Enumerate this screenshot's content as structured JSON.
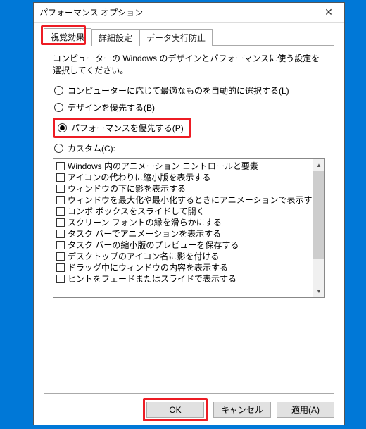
{
  "title": "パフォーマンス オプション",
  "tabs": {
    "visual": "視覚効果",
    "advanced": "詳細設定",
    "dep": "データ実行防止"
  },
  "description": "コンピューターの Windows のデザインとパフォーマンスに使う設定を選択してください。",
  "radios": {
    "auto": "コンピューターに応じて最適なものを自動的に選択する(L)",
    "design": "デザインを優先する(B)",
    "perf": "パフォーマンスを優先する(P)",
    "custom": "カスタム(C):"
  },
  "options": [
    "Windows 内のアニメーション コントロールと要素",
    "アイコンの代わりに縮小版を表示する",
    "ウィンドウの下に影を表示する",
    "ウィンドウを最大化や最小化するときにアニメーションで表示する",
    "コンボ ボックスをスライドして開く",
    "スクリーン フォントの縁を滑らかにする",
    "タスク バーでアニメーションを表示する",
    "タスク バーの縮小版のプレビューを保存する",
    "デスクトップのアイコン名に影を付ける",
    "ドラッグ中にウィンドウの内容を表示する",
    "ヒントをフェードまたはスライドで表示する"
  ],
  "buttons": {
    "ok": "OK",
    "cancel": "キャンセル",
    "apply": "適用(A)"
  },
  "highlights": {
    "tab": "visual",
    "radio": "perf",
    "button": "ok"
  }
}
